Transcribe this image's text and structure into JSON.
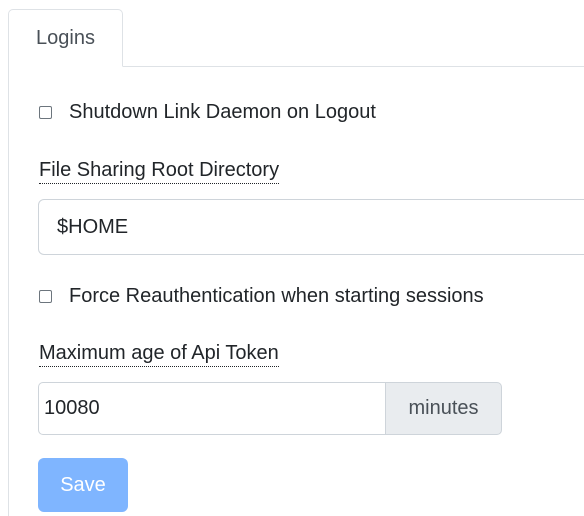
{
  "tabs": [
    {
      "label": "Logins",
      "active": true
    }
  ],
  "settings": {
    "shutdown_daemon": {
      "label": "Shutdown Link Daemon on Logout",
      "checked": false
    },
    "root_directory": {
      "label": "File Sharing Root Directory",
      "value": "$HOME"
    },
    "force_reauth": {
      "label": "Force Reauthentication when starting sessions",
      "checked": false
    },
    "api_token_age": {
      "label": "Maximum age of Api Token",
      "value": "10080",
      "unit": "minutes"
    }
  },
  "actions": {
    "save_label": "Save"
  },
  "colors": {
    "primary_disabled": "#7fb5ff",
    "border": "#dee2e6",
    "addon_bg": "#e9ecef"
  }
}
